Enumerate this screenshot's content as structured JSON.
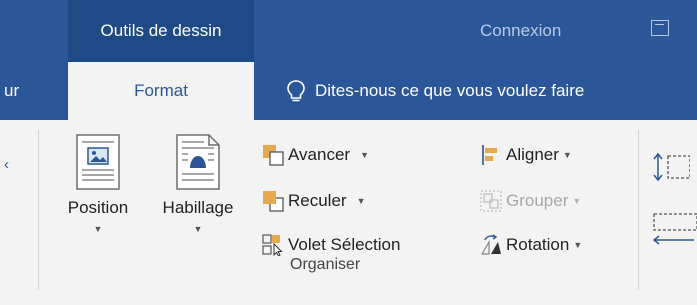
{
  "titlebar": {
    "context_tab": "Outils de dessin",
    "account": "Connexion"
  },
  "tabs": {
    "partial": "ur",
    "active": "Format",
    "tell_me": "Dites-nous ce que vous voulez faire"
  },
  "ribbon": {
    "group_label": "Organiser",
    "position_label": "Position",
    "wrap_label": "Habillage",
    "bring_forward_label": "Avancer",
    "send_backward_label": "Reculer",
    "selection_pane_label": "Volet Sélection",
    "align_label": "Aligner",
    "group_objects_label": "Grouper",
    "rotate_label": "Rotation"
  },
  "colors": {
    "ribbon_blue": "#2b579a",
    "context_tab_bg": "#1e4a86",
    "ribbon_bg": "#f3f3f3"
  },
  "icons": {
    "partial_left": "chevron-icon",
    "position": "position-picture-icon",
    "wrap": "wrap-text-icon",
    "bring_forward": "bring-forward-icon",
    "send_backward": "send-backward-icon",
    "selection_pane": "selection-pane-icon",
    "align": "align-icon",
    "group": "group-objects-icon",
    "rotate": "rotate-icon",
    "size_height": "shape-height-icon",
    "size_width": "shape-width-icon"
  }
}
